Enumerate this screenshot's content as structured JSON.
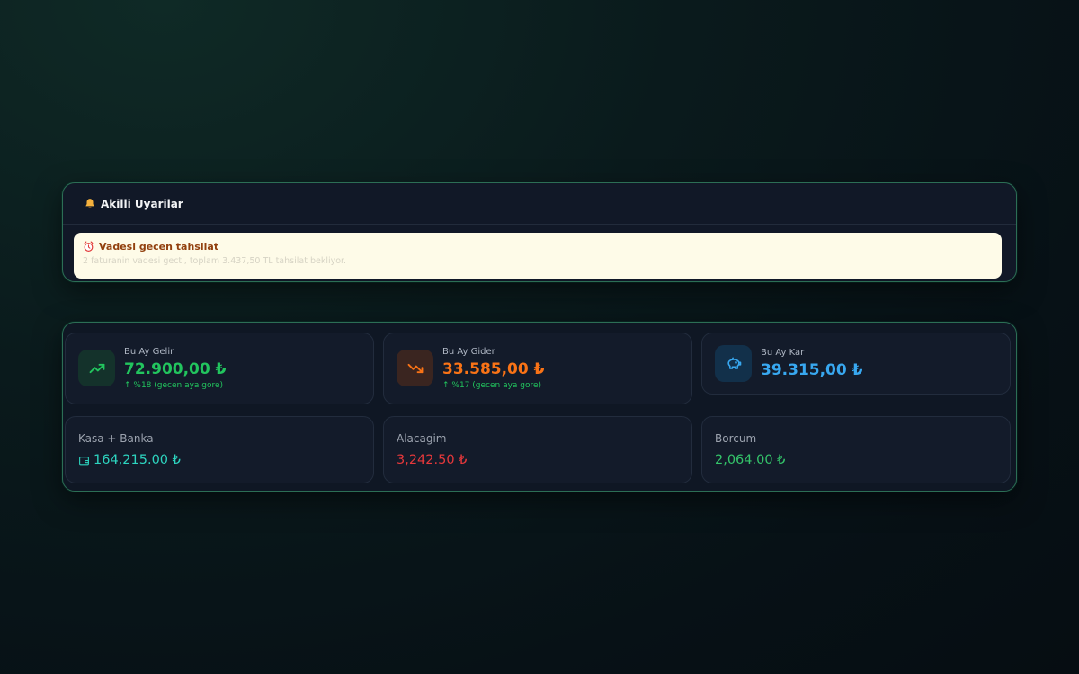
{
  "alerts": {
    "title": "Akilli Uyarilar",
    "icon": "bell-icon",
    "items": [
      {
        "icon": "alarm-clock-icon",
        "title": "Vadesi gecen tahsilat",
        "description": "2 faturanin vadesi gecti, toplam 3.437,50 TL tahsilat bekliyor."
      }
    ]
  },
  "kpis": [
    {
      "label": "Bu Ay Gelir",
      "value": "72.900,00 ₺",
      "trend": "↑ %18 (gecen aya gore)",
      "icon": "trending-up-icon",
      "color": "#22c55e"
    },
    {
      "label": "Bu Ay Gider",
      "value": "33.585,00 ₺",
      "trend": "↑ %17 (gecen aya gore)",
      "icon": "trending-down-icon",
      "color": "#f97316"
    },
    {
      "label": "Bu Ay Kar",
      "value": "39.315,00 ₺",
      "icon": "piggy-bank-icon",
      "color": "#38a8f0"
    }
  ],
  "balances": [
    {
      "label": "Kasa + Banka",
      "value": "164,215.00 ₺",
      "icon": "wallet-icon",
      "color": "#2dd4bf"
    },
    {
      "label": "Alacagim",
      "value": "3,242.50 ₺",
      "color": "#e5383b"
    },
    {
      "label": "Borcum",
      "value": "2,064.00 ₺",
      "color": "#34c46a"
    }
  ]
}
